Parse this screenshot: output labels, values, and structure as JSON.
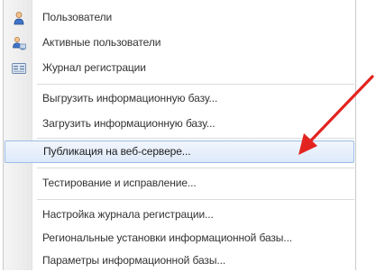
{
  "menu": {
    "items": [
      {
        "label": "Пользователи",
        "icon": "user-icon"
      },
      {
        "label": "Активные пользователи",
        "icon": "active-users-icon"
      },
      {
        "label": "Журнал регистрации",
        "icon": "event-log-icon"
      },
      {
        "label": "Выгрузить информационную базу..."
      },
      {
        "label": "Загрузить информационную базу..."
      },
      {
        "label": "Публикация на веб-сервере..."
      },
      {
        "label": "Тестирование и исправление..."
      },
      {
        "label": "Настройка журнала регистрации..."
      },
      {
        "label": "Региональные установки информационной базы..."
      },
      {
        "label": "Параметры информационной базы..."
      }
    ],
    "highlighted_item": "Публикация на веб-сервере..."
  },
  "colors": {
    "highlight_border": "#9bbde8",
    "highlight_fill": "#dde9f9",
    "arrow": "#e3231f"
  }
}
